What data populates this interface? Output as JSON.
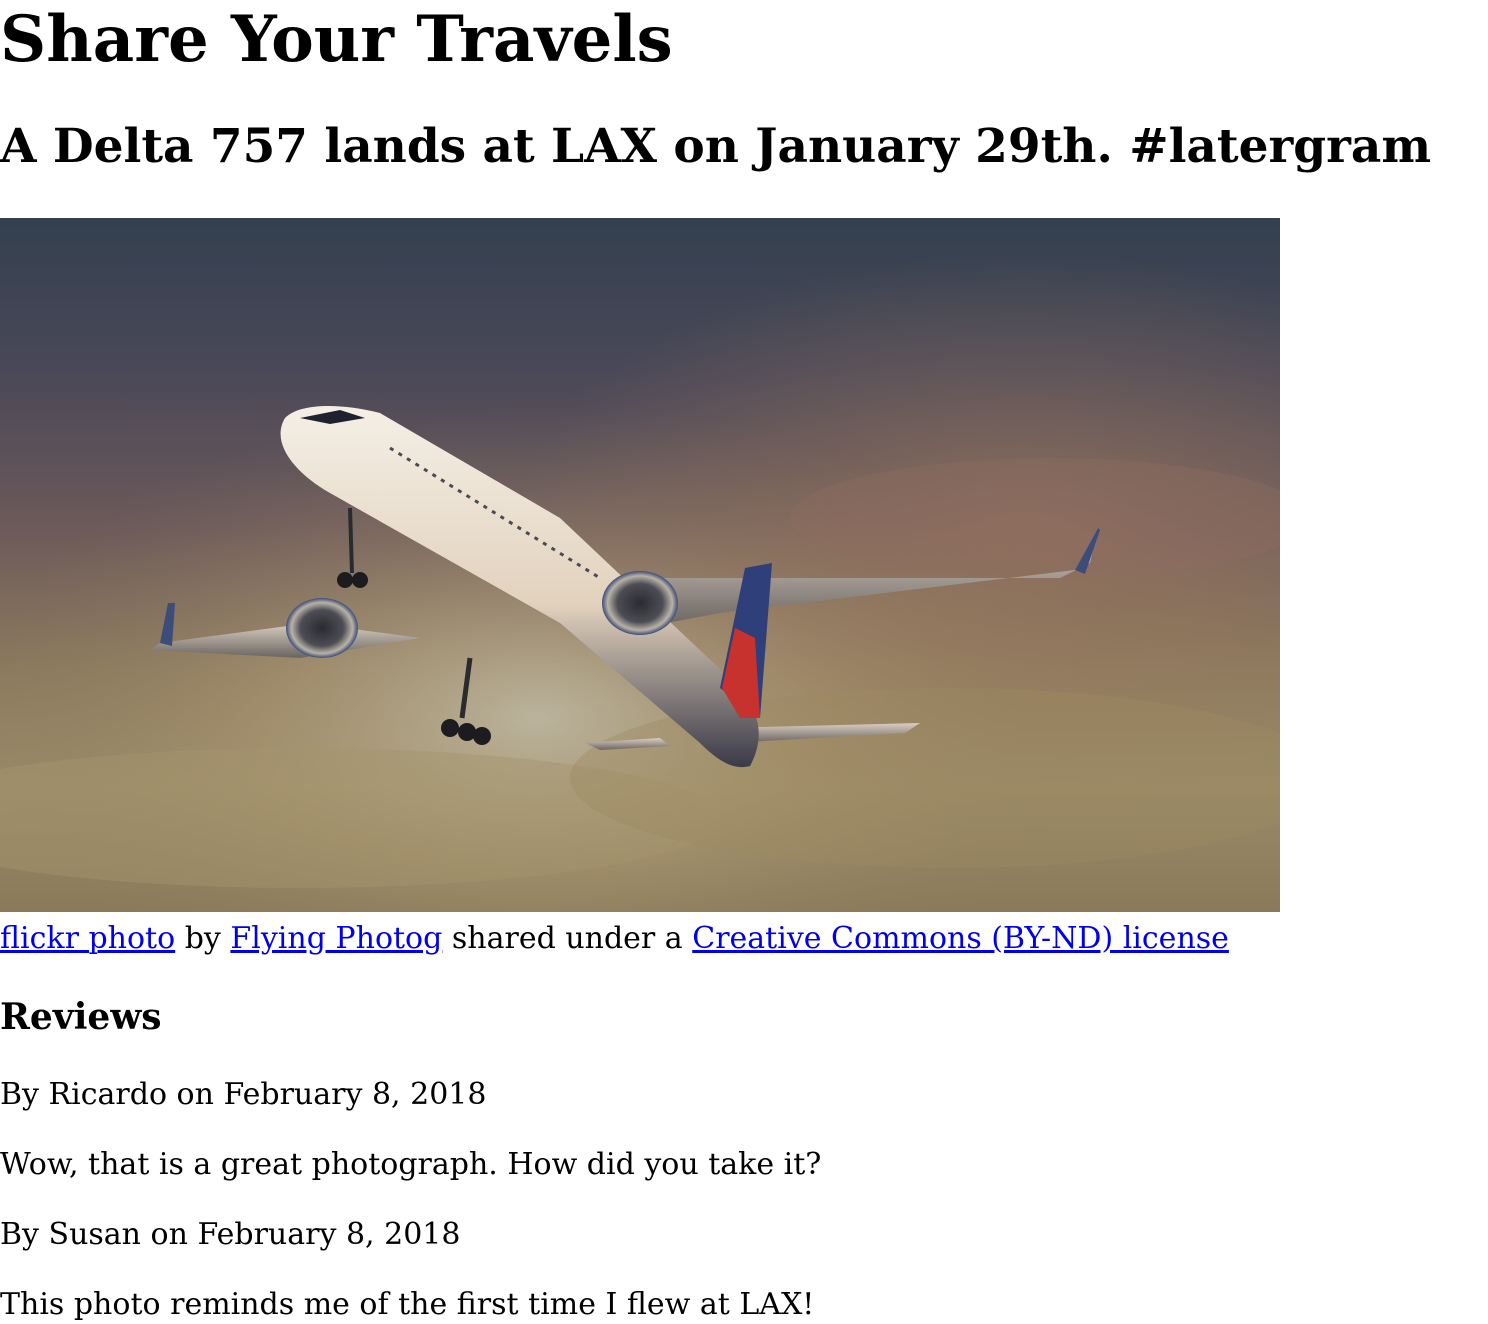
{
  "page": {
    "title": "Share Your Travels"
  },
  "post": {
    "title": "A Delta 757 lands at LAX on January 29th. #latergram",
    "photo_subject": "Delta airplane in flight against a dusky cloudy sky",
    "credit": {
      "link1": "flickr photo",
      "text1": "by",
      "link2": "Flying Photog",
      "text2": "shared under a",
      "link3": "Creative Commons (BY-ND) license"
    }
  },
  "reviews": {
    "heading": "Reviews",
    "items": [
      {
        "meta": "By Ricardo on February 8, 2018",
        "text": "Wow, that is a great photograph. How did you take it?"
      },
      {
        "meta": "By Susan on February 8, 2018",
        "text": "This photo reminds me of the first time I flew at LAX!"
      }
    ]
  },
  "colors": {
    "link": "#0000ee",
    "text": "#000000",
    "background": "#ffffff"
  }
}
